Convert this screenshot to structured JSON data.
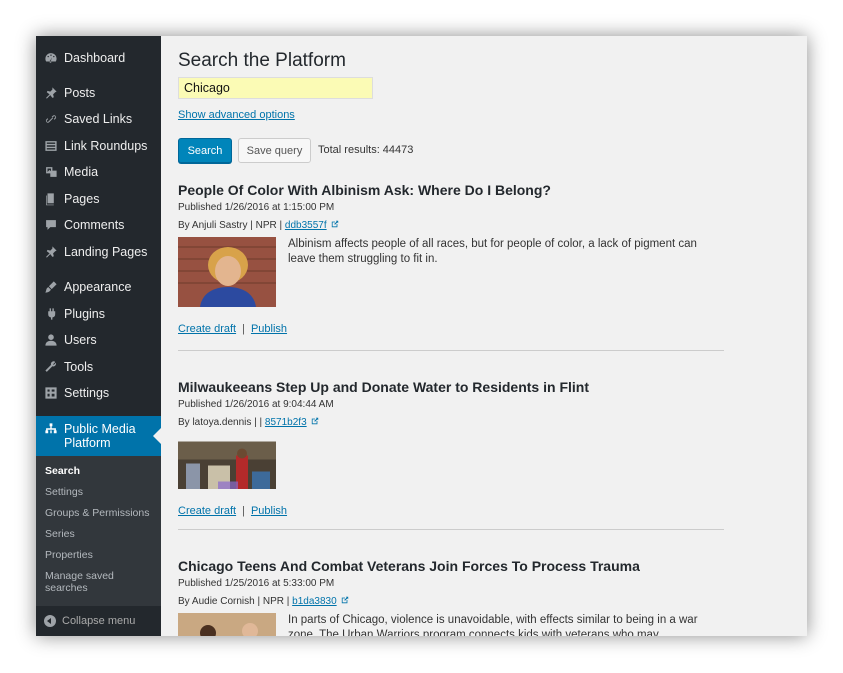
{
  "sidebar": {
    "items": [
      {
        "label": "Dashboard",
        "icon": "dashboard-icon"
      },
      {
        "label": "Posts",
        "icon": "pin-icon"
      },
      {
        "label": "Saved Links",
        "icon": "link-icon"
      },
      {
        "label": "Link Roundups",
        "icon": "list-icon"
      },
      {
        "label": "Media",
        "icon": "media-icon"
      },
      {
        "label": "Pages",
        "icon": "pages-icon"
      },
      {
        "label": "Comments",
        "icon": "comment-icon"
      },
      {
        "label": "Landing Pages",
        "icon": "pin-icon"
      },
      {
        "label": "Appearance",
        "icon": "brush-icon"
      },
      {
        "label": "Plugins",
        "icon": "plugin-icon"
      },
      {
        "label": "Users",
        "icon": "users-icon"
      },
      {
        "label": "Tools",
        "icon": "wrench-icon"
      },
      {
        "label": "Settings",
        "icon": "settings-icon"
      },
      {
        "label": "Public Media Platform",
        "icon": "network-icon"
      }
    ],
    "submenu": [
      "Search",
      "Settings",
      "Groups & Permissions",
      "Series",
      "Properties",
      "Manage saved searches"
    ],
    "collapse_label": "Collapse menu"
  },
  "main": {
    "title": "Search the Platform",
    "search_value": "Chicago",
    "advanced_link": "Show advanced options",
    "search_button": "Search",
    "save_query_button": "Save query",
    "total_label": "Total results:",
    "total_value": "44473"
  },
  "results": [
    {
      "title": "People Of Color With Albinism Ask: Where Do I Belong?",
      "published": "Published 1/26/2016 at 1:15:00 PM",
      "byline": "By Anjuli Sastry | NPR | ",
      "guid": "ddb3557f",
      "description": "Albinism affects people of all races, but for people of color, a lack of pigment can leave them struggling to fit in.",
      "create_draft": "Create draft",
      "publish": "Publish"
    },
    {
      "title": "Milwaukeeans Step Up and Donate Water to Residents in Flint",
      "published": "Published 1/26/2016 at 9:04:44 AM",
      "byline": "By latoya.dennis | | ",
      "guid": "8571b2f3",
      "description": "",
      "create_draft": "Create draft",
      "publish": "Publish"
    },
    {
      "title": "Chicago Teens And Combat Veterans Join Forces To Process Trauma",
      "published": "Published 1/25/2016 at 5:33:00 PM",
      "byline": "By Audie Cornish | NPR | ",
      "guid": "b1da3830",
      "description": "In parts of Chicago, violence is unavoidable, with effects similar to being in a war zone. The Urban Warriors program connects kids with veterans who may understand",
      "create_draft": "Create draft",
      "publish": "Publish"
    }
  ],
  "colors": {
    "sidebar_bg": "#23282d",
    "active_bg": "#0073aa",
    "link": "#0073aa",
    "button_primary": "#0085ba",
    "search_highlight": "#fbfbb5"
  }
}
